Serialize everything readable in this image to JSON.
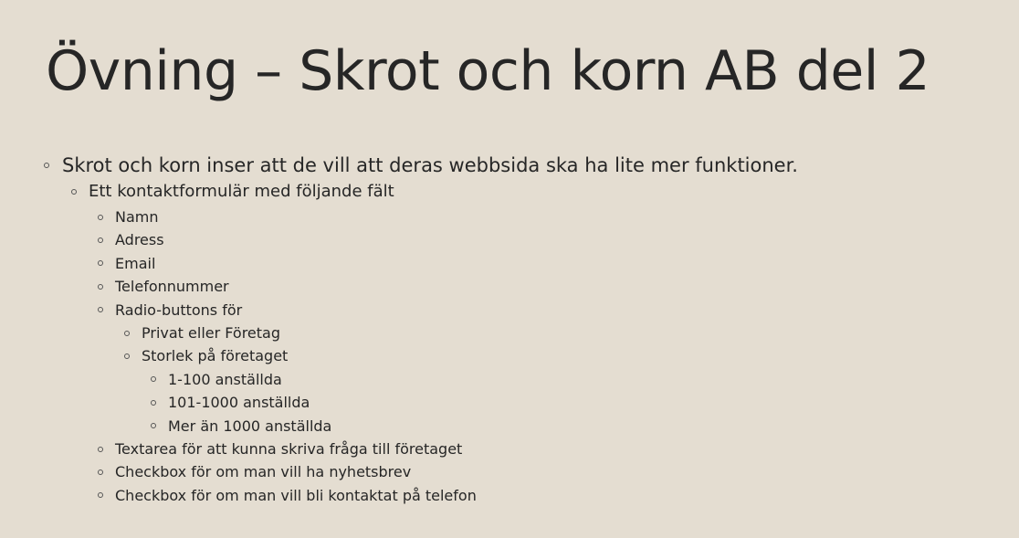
{
  "slide": {
    "title": "Övning – Skrot och korn AB del 2",
    "bullets": [
      {
        "level": 0,
        "text": "Skrot och korn inser att de vill att deras webbsida ska ha lite mer funktioner."
      },
      {
        "level": 1,
        "text": "Ett kontaktformulär med följande fält"
      },
      {
        "level": 2,
        "text": "Namn"
      },
      {
        "level": 2,
        "text": "Adress"
      },
      {
        "level": 2,
        "text": "Email"
      },
      {
        "level": 2,
        "text": "Telefonnummer"
      },
      {
        "level": 2,
        "text": "Radio-buttons för"
      },
      {
        "level": 3,
        "text": "Privat eller Företag"
      },
      {
        "level": 3,
        "text": "Storlek på företaget"
      },
      {
        "level": 4,
        "text": "1-100 anställda"
      },
      {
        "level": 4,
        "text": "101-1000 anställda"
      },
      {
        "level": 4,
        "text": "Mer än 1000 anställda"
      },
      {
        "level": 2,
        "text": "Textarea för att kunna skriva fråga till företaget"
      },
      {
        "level": 2,
        "text": "Checkbox för om man vill ha nyhetsbrev"
      },
      {
        "level": 2,
        "text": "Checkbox för om man vill bli kontaktat på telefon"
      }
    ]
  },
  "colors": {
    "background": "#e4ddd1",
    "text": "#262626",
    "bullet": "#555555"
  }
}
